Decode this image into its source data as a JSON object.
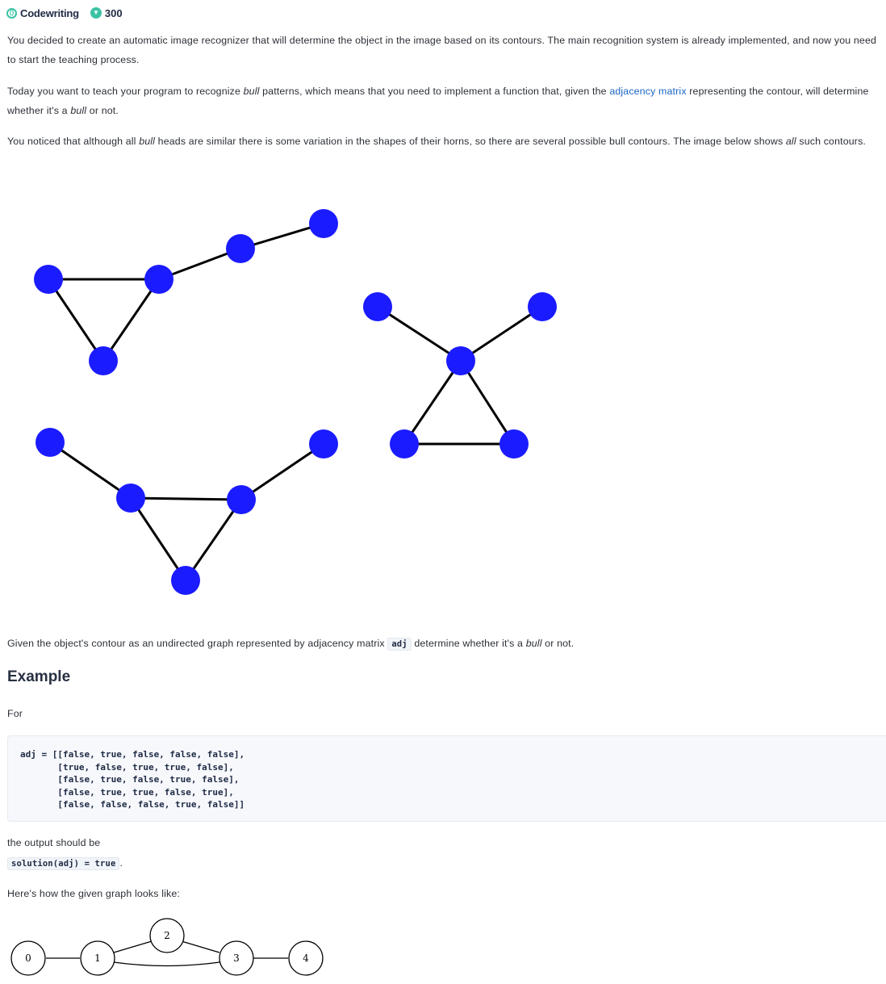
{
  "header": {
    "brand": "Codewriting",
    "score": "300"
  },
  "description": {
    "p1": "You decided to create an automatic image recognizer that will determine the object in the image based on its contours. The main recognition system is already implemented, and now you need to start the teaching process.",
    "p2_before": "Today you want to teach your program to recognize ",
    "p2_em1": "bull",
    "p2_mid": " patterns, which means that you need to implement a function that, given the ",
    "p2_link": "adjacency matrix",
    "p2_after": " representing the contour, will determine whether it's a ",
    "p2_em2": "bull",
    "p2_end": " or not.",
    "p3_before": "You noticed that although all ",
    "p3_em1": "bull",
    "p3_mid": " heads are similar there is some variation in the shapes of their horns, so there are several possible bull contours. The image below shows ",
    "p3_em2": "all",
    "p3_end": " such contours.",
    "p4_before": "Given the object's contour as an undirected graph represented by adjacency matrix ",
    "p4_code": "adj",
    "p4_mid": " determine whether it's a ",
    "p4_em": "bull",
    "p4_end": " or not."
  },
  "example": {
    "heading": "Example",
    "for_label": "For",
    "code": "adj = [[false, true, false, false, false],\n       [true, false, true, true, false],\n       [false, true, false, true, false],\n       [false, true, true, false, true],\n       [false, false, false, true, false]]",
    "output_label": "the output should be",
    "output_code": "solution(adj) = true",
    "output_period": ".",
    "graph_caption": "Here's how the given graph looks like:",
    "node_labels": [
      "0",
      "1",
      "2",
      "3",
      "4"
    ]
  },
  "colors": {
    "node": "#1b1bff",
    "edge": "#000000",
    "link": "#1a66c4",
    "accent": "#3cc3a4"
  }
}
